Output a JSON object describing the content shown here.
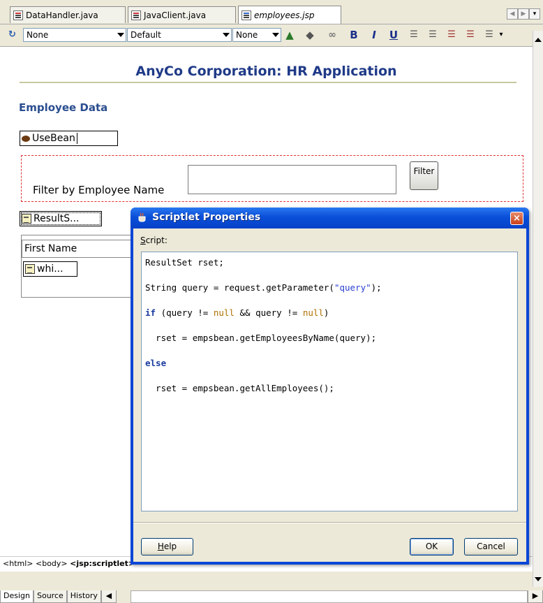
{
  "tabs": [
    {
      "label": "DataHandler.java",
      "active": false
    },
    {
      "label": "JavaClient.java",
      "active": false
    },
    {
      "label": "employees.jsp",
      "active": true
    }
  ],
  "toolbar": {
    "block_format": "None",
    "font": "Default",
    "size": "None",
    "bold": "B",
    "italic": "I",
    "underline": "U"
  },
  "page": {
    "heading": "AnyCo Corporation: HR Application",
    "subheading": "Employee Data",
    "usebean_label": "UseBean",
    "filter_label": "Filter by Employee Name",
    "filter_button": "Filter",
    "filter_value": "",
    "resultset_label": "ResultS...",
    "table_first_col": "First Name",
    "while_label": "whi..."
  },
  "breadcrumb": {
    "items": [
      "<html>",
      "<body>",
      "<jsp:scriptlet>"
    ]
  },
  "bottom_tabs": [
    "Design",
    "Source",
    "History"
  ],
  "dialog": {
    "title": "Scriptlet Properties",
    "script_label": "Script:",
    "code_lines": [
      "ResultSet rset;",
      "String query = request.getParameter(\"query\");",
      "if (query != null && query != null)",
      "  rset = empsbean.getEmployeesByName(query);",
      "else",
      "  rset = empsbean.getAllEmployees();"
    ],
    "help_button": "Help",
    "ok_button": "OK",
    "cancel_button": "Cancel",
    "close_glyph": "×"
  },
  "colors": {
    "heading": "#1f3a87",
    "dialog_title_bar": "#0a4fd8",
    "form_border": "#e03030",
    "keyword": "#1b3ca0",
    "literal": "#b07000",
    "string": "#2a40d0"
  }
}
